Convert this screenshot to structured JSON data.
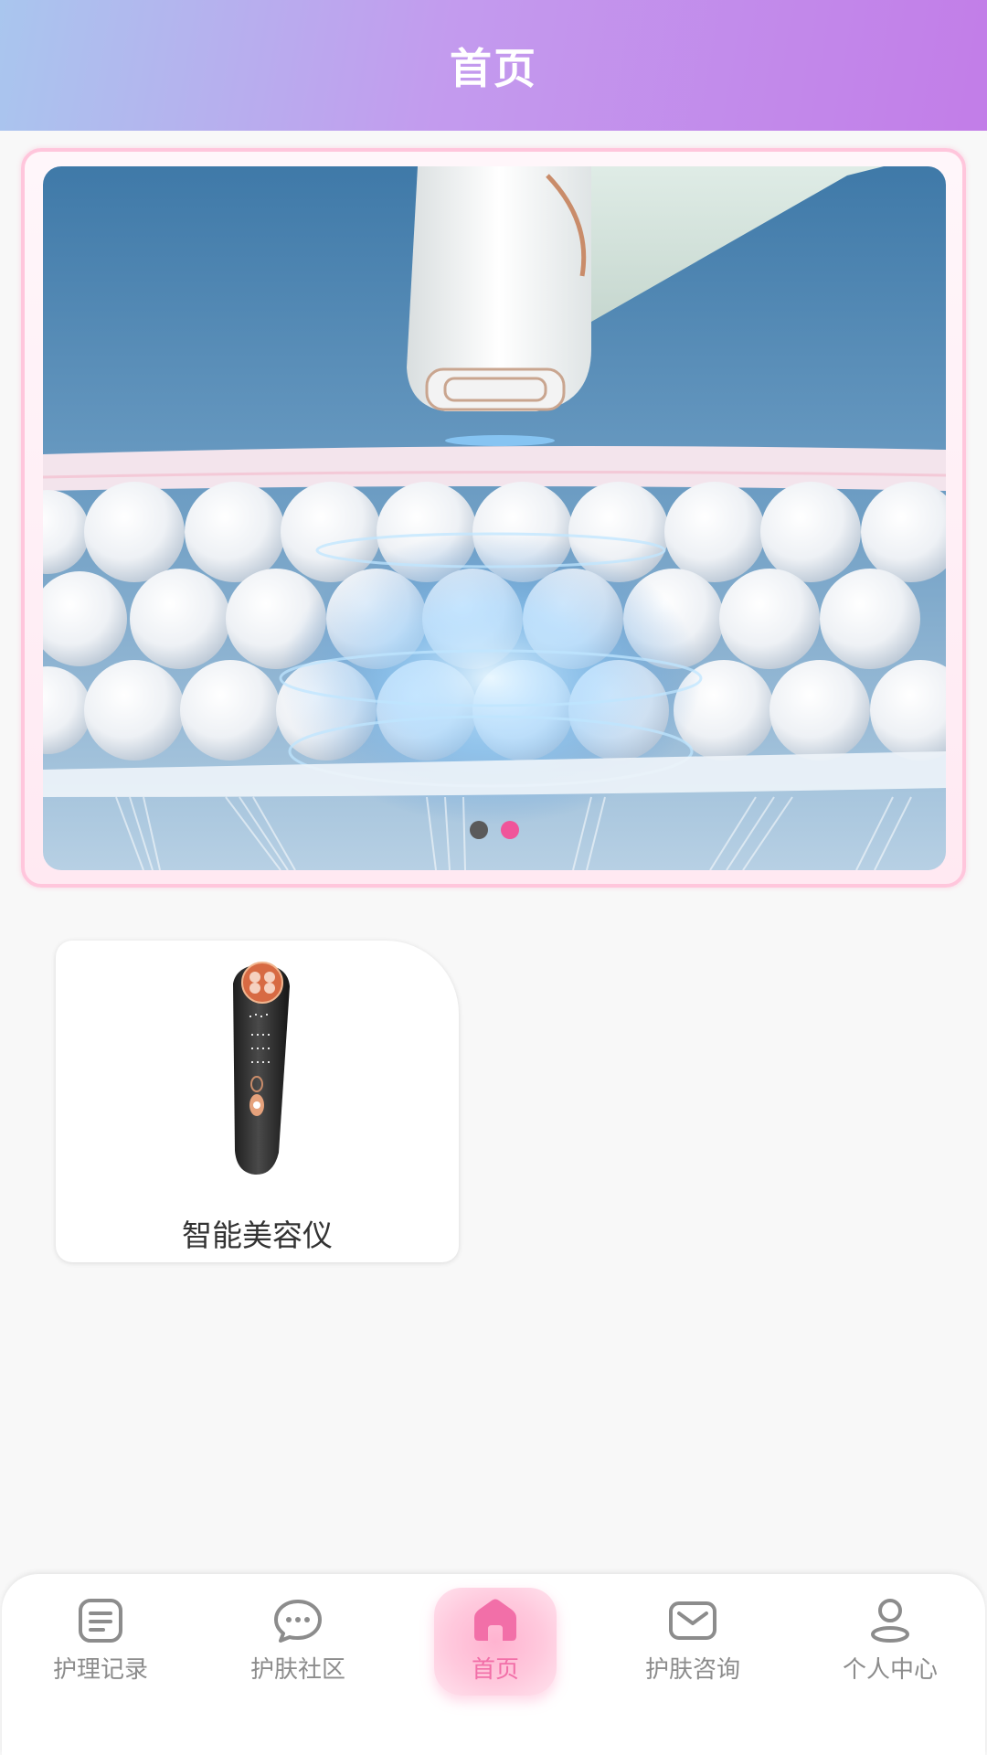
{
  "header": {
    "title": "首页"
  },
  "banner": {
    "slide_count": 2,
    "active_index": 1,
    "colors": {
      "active_dot": "#f0559a",
      "inactive_dot": "#5a5a5a"
    }
  },
  "products": [
    {
      "label": "智能美容仪",
      "icon": "beauty-device-image"
    }
  ],
  "nav": {
    "items": [
      {
        "label": "护理记录",
        "icon": "document-icon",
        "active": false
      },
      {
        "label": "护肤社区",
        "icon": "chat-bubble-icon",
        "active": false
      },
      {
        "label": "首页",
        "icon": "home-icon",
        "active": true
      },
      {
        "label": "护肤咨询",
        "icon": "mail-icon",
        "active": false
      },
      {
        "label": "个人中心",
        "icon": "user-icon",
        "active": false
      }
    ],
    "colors": {
      "active": "#f26fa8",
      "inactive": "#8c8c8c"
    }
  }
}
